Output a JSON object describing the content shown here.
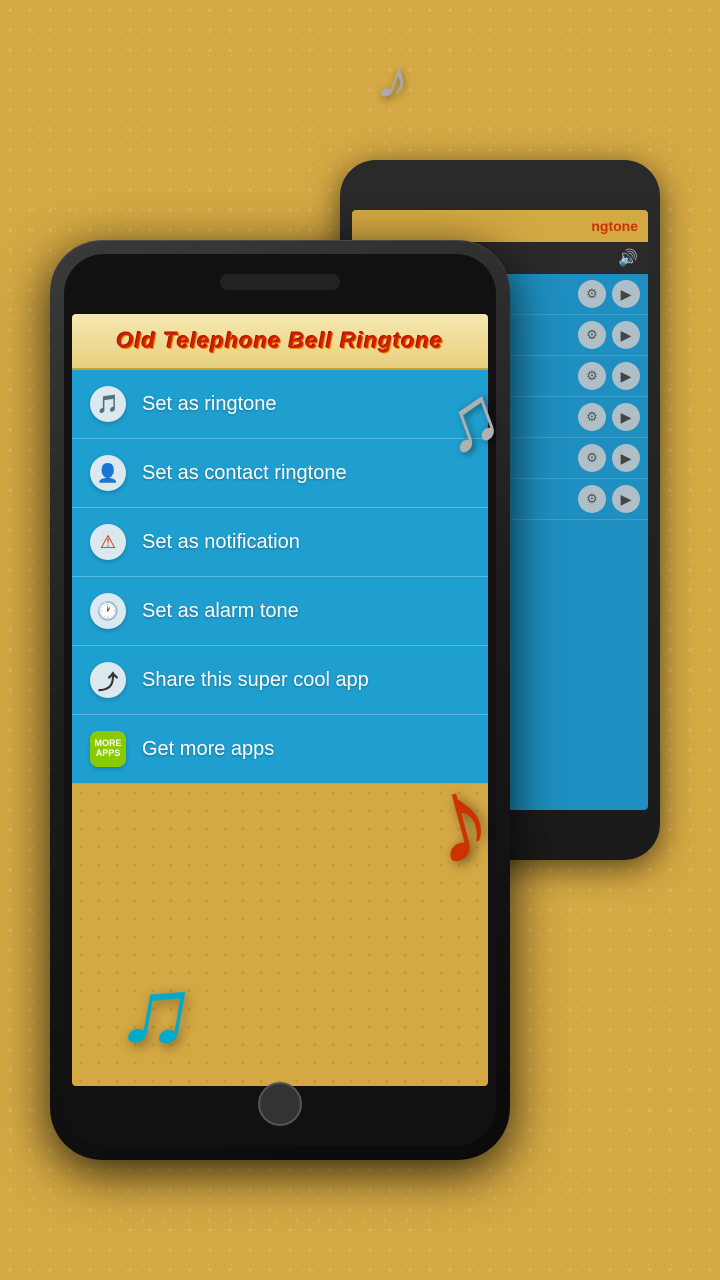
{
  "app": {
    "title": "Old Telephone Bell Ringtone",
    "background_color": "#d4a843",
    "accent_color": "#1e9fd0"
  },
  "menu": {
    "items": [
      {
        "id": "set-ringtone",
        "label": "Set as ringtone",
        "icon": "🎵",
        "icon_bg": "#f0f0f0"
      },
      {
        "id": "set-contact-ringtone",
        "label": "Set as contact ringtone",
        "icon": "👤",
        "icon_bg": "#f0f0f0"
      },
      {
        "id": "set-notification",
        "label": "Set as notification",
        "icon": "⚠",
        "icon_bg": "#f0f0f0"
      },
      {
        "id": "set-alarm",
        "label": "Set as alarm tone",
        "icon": "🕐",
        "icon_bg": "#f0f0f0"
      },
      {
        "id": "share-app",
        "label": "Share this super cool app",
        "icon": "↗",
        "icon_bg": "#f0f0f0"
      },
      {
        "id": "more-apps",
        "label": "Get more apps",
        "icon": "MORE\nAPPS",
        "icon_bg": "#88cc00"
      }
    ]
  },
  "back_phone": {
    "header_text": "ngtone",
    "rows": 6
  },
  "decorations": {
    "note_silver_top": "♪",
    "note_silver": "♫",
    "note_red": "♪",
    "note_blue": "♫"
  }
}
